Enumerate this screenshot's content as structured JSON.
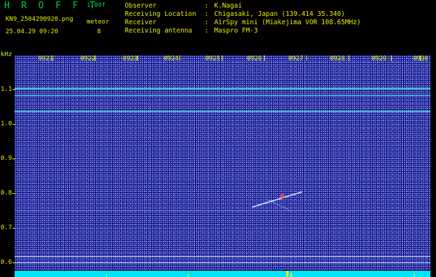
{
  "app": {
    "brand": "H R O F F T",
    "version": "1.00f",
    "filename": "KN9_2504290920.png",
    "meteor_label": "meteor",
    "meteor_count": "8",
    "datetime": "25.04.29 09:20"
  },
  "info": [
    {
      "key": "Observer",
      "value": "K.Nagai"
    },
    {
      "key": "Receiving Location",
      "value": "Chigasaki, Japan (139.414 35.340)"
    },
    {
      "key": "Receiver",
      "value": "AirSpy mini (Miakejima VOR 108.65MHz)"
    },
    {
      "key": "Receiving antenna",
      "value": "Maspro FM-3"
    }
  ],
  "axis": {
    "unit": "kHz",
    "time_labels": [
      "0921",
      "0922",
      "0923",
      "0924",
      "0925",
      "0926",
      "0927",
      "0928",
      "0929",
      "0930"
    ],
    "freq_labels": [
      "1.1",
      "1.0",
      "0.9",
      "0.8",
      "0.7",
      "0.6"
    ]
  },
  "colors": {
    "text": "#e8f000",
    "brand": "#00d04a",
    "background": "#000000",
    "spectrum": "#1a0f88",
    "floor": "#00e5ff"
  }
}
